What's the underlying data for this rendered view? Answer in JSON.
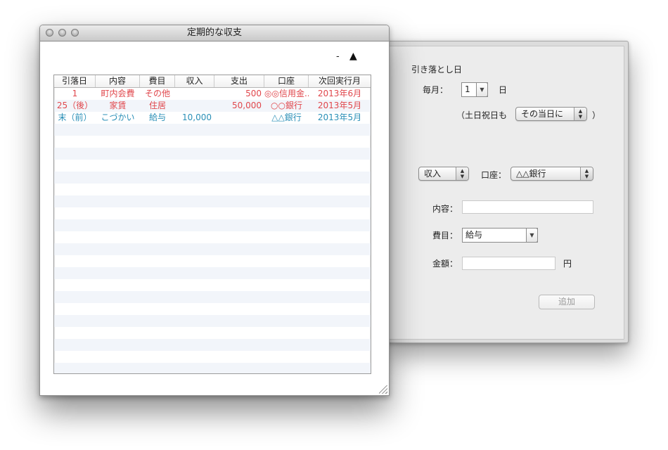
{
  "window": {
    "title": "定期的な収支",
    "remove_label": "-",
    "toggle_label": "▲"
  },
  "table": {
    "columns": [
      "引落日",
      "内容",
      "費目",
      "収入",
      "支出",
      "口座",
      "次回実行月"
    ],
    "rows": [
      {
        "day": "1",
        "content": "町内会費",
        "category": "その他",
        "income": "",
        "expense": "500",
        "account": "◎◎信用金...",
        "next": "2013年6月",
        "color": "#e0474c"
      },
      {
        "day": "25（後）",
        "content": "家賃",
        "category": "住居",
        "income": "",
        "expense": "50,000",
        "account": "○○銀行",
        "next": "2013年5月",
        "color": "#e0474c"
      },
      {
        "day": "末（前）",
        "content": "こづかい",
        "category": "給与",
        "income": "10,000",
        "expense": "",
        "account": "△△銀行",
        "next": "2013年5月",
        "color": "#2a8fb7"
      }
    ],
    "stripe_color": "#f2f5fa"
  },
  "drawer": {
    "section_title": "引き落とし日",
    "monthly_label": "毎月：",
    "day_value": "1",
    "day_unit": "日",
    "holiday_prefix": "（土日祝日も",
    "holiday_option": "その当日に",
    "holiday_suffix": "）",
    "type_option": "収入",
    "account_label": "口座：",
    "account_option": "△△銀行",
    "content_label": "内容：",
    "content_value": "",
    "category_label": "費目：",
    "category_value": "給与",
    "amount_label": "金額：",
    "amount_value": "",
    "amount_unit": "円",
    "add_button": "追加"
  }
}
